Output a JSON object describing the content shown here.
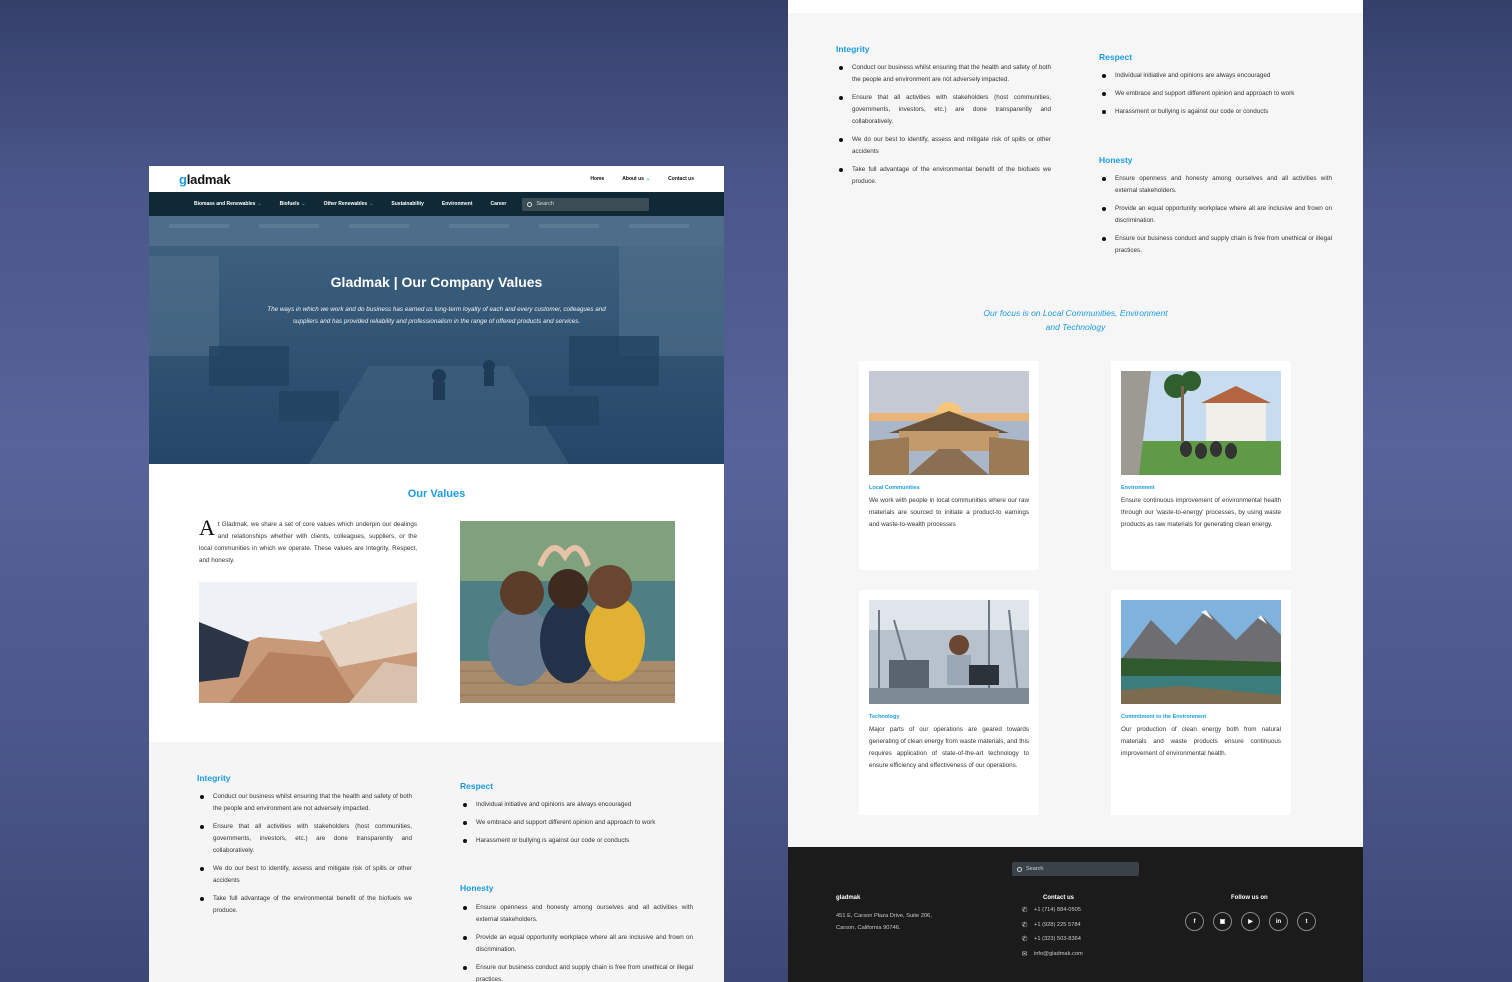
{
  "site": {
    "logo_g": "g",
    "logo_rest": "ladmak",
    "top_nav": [
      "Home",
      "About us",
      "Contact us"
    ],
    "main_nav": [
      "Biomass and Renewables",
      "Biofuels",
      "Other Renewables",
      "Sustainability",
      "Environment",
      "Career"
    ],
    "search_placeholder": "Search"
  },
  "hero": {
    "title": "Gladmak | Our Company Values",
    "subtitle": "The ways in which we work and do business has earned us long-term loyalty of each and every customer, colleagues and suppliers and has provided reliability and professionalism in the range of offered products and services."
  },
  "values_section": {
    "title": "Our Values",
    "dropcap": "A",
    "intro": "t Gladmak, we share a set of core values which underpin our dealings and relationships whether with clients, colleagues, suppliers, or the local communities in which we operate. These values are Integrity, Respect, and honesty."
  },
  "values": {
    "integrity": {
      "title": "Integrity",
      "items": [
        "Conduct our business whilst ensuring that the health and safety of both the people and environment are not adversely impacted.",
        "Ensure that all activities with stakeholders (host communities, governments, investors, etc.) are done transparently and collaboratively.",
        "We do our best to identify, assess and mitigate risk of spills or other accidents",
        "Take full advantage of the environmental benefit of the biofuels we produce."
      ]
    },
    "respect": {
      "title": "Respect",
      "items": [
        "Individual initiative and opinions are always encouraged",
        "We embrace and support different opinion and approach to work",
        "Harassment or bullying is against our code or conducts"
      ]
    },
    "honesty": {
      "title": "Honesty",
      "items": [
        "Ensure openness and honesty among ourselves and all activities with external stakeholders.",
        "Provide an equal opportunity workplace where all are inclusive and frown on discrimination.",
        "Ensure our business conduct and supply chain is free from unethical or illegal practices."
      ]
    }
  },
  "focus": {
    "line1": "Our focus is on Local Communities, Environment",
    "line2": "and Technology",
    "cards": [
      {
        "title": "Local Communities",
        "text": "We work with people in local communities where our raw materials are sourced to initiate a product-to earnings and waste-to-wealth processes"
      },
      {
        "title": "Environment",
        "text": "Ensure continuous improvement of environmental health through our 'waste-to-energy' processes, by using waste products as raw materials for generating clean energy."
      },
      {
        "title": "Technology",
        "text": "Major parts of our operations are geared towards generating of clean energy from waste materials, and this requires application of state-of-the-art technology to ensure efficiency and effectiveness of our operations."
      },
      {
        "title": "Commitment to the Environment",
        "text": "Our production of clean energy both from natural materials and waste products ensure continuous improvement of environmental health."
      }
    ]
  },
  "footer": {
    "search_placeholder": "Search",
    "logo": "gladmak",
    "address": "451 E, Carson Plaza Drive, Suite 206, Carson, California 90746.",
    "contact_title": "Contact us",
    "contacts": [
      "+1 (714) 884-0505",
      "+1 (928) 225 5784",
      "+1 (323) 503-8364",
      "info@gladmak.com"
    ],
    "follow_title": "Follow us on",
    "social": [
      "facebook-icon",
      "instagram-icon",
      "youtube-icon",
      "linkedin-icon",
      "twitter-icon"
    ]
  },
  "colors": {
    "accent": "#1a9be0",
    "nav_dark": "#0f2a36",
    "footer_dark": "#1b1b1b"
  }
}
